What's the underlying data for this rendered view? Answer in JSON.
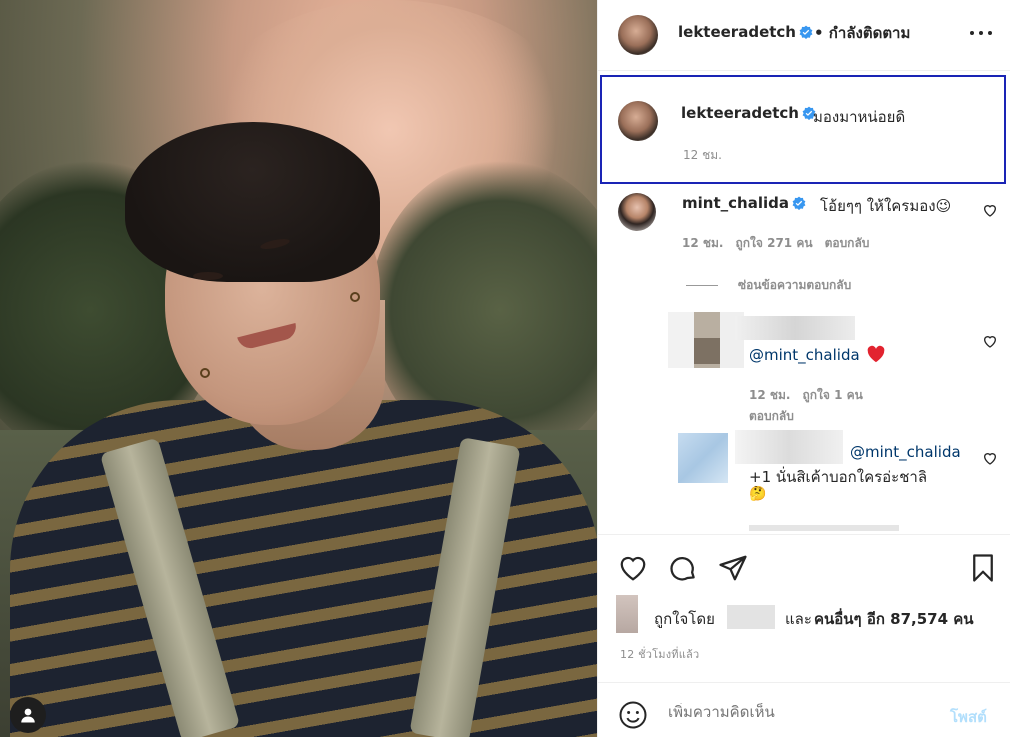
{
  "post": {
    "photo_alt": "",
    "author": {
      "username": "lekteeradetch",
      "follow_status": "• กำลังติดตาม"
    },
    "caption": {
      "username": "lekteeradetch",
      "text": "มองมาหน่อยดิ",
      "time": "12 ชม."
    }
  },
  "comments": [
    {
      "username": "mint_chalida",
      "text": "โอ้ยๆๆ ให้ใครมอง😉",
      "time": "12 ชม.",
      "likes": "ถูกใจ 271 คน",
      "reply_label": "ตอบกลับ",
      "hide_replies": "ซ่อนข้อความตอบกลับ"
    }
  ],
  "replies": [
    {
      "mention": "@mint_chalida",
      "time": "12 ชม.",
      "likes": "ถูกใจ 1 คน",
      "reply_label": "ตอบกลับ"
    },
    {
      "mention": "@mint_chalida",
      "text": "+1 นั่นสิเค้าบอกใครอ่ะชาลิ",
      "emoji": "🤔"
    }
  ],
  "likes": {
    "liked_by": "ถูกใจโดย",
    "and": "และ",
    "others": "คนอื่นๆ อีก 87,574 คน"
  },
  "posted_ago": "12 ชั่วโมงที่แล้ว",
  "add_comment": {
    "placeholder": "เพิ่มความคิดเห็น",
    "post_label": "โพสต์"
  },
  "colors": {
    "verified": "#3897f0",
    "highlight_border": "#1a24b5",
    "mention": "#00376b",
    "post_disabled": "#b2dffc"
  }
}
